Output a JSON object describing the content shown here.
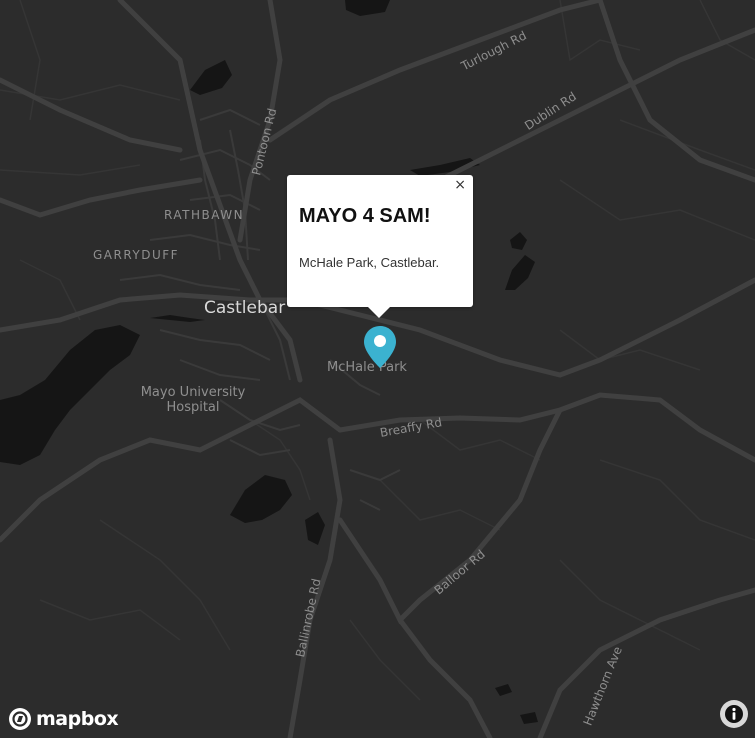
{
  "map": {
    "labels": {
      "town": "Castlebar",
      "rathbawn": "RATHBAWN",
      "garryduff": "GARRYDUFF",
      "hospital_line1": "Mayo University",
      "hospital_line2": "Hospital",
      "mchale_park": "McHale Park",
      "turlough_rd": "Turlough Rd",
      "dublin_rd": "Dublin Rd",
      "pontoon_rd": "Pontoon Rd",
      "breaffy_rd": "Breaffy Rd",
      "ballinrobe_rd": "Ballinrobe Rd",
      "balloor_rd": "Balloor Rd",
      "hawthorn_ave": "Hawthorn Ave"
    },
    "colors": {
      "background": "#2c2c2c",
      "road": "#3d3d3d",
      "water": "#151515",
      "marker": "#3bb2d0"
    }
  },
  "popup": {
    "title": "MAYO 4 SAM!",
    "body": "McHale Park, Castlebar.",
    "close": "×"
  },
  "marker": {
    "icon": "map-pin-icon"
  },
  "attribution": {
    "logo_text": "mapbox",
    "info_icon": "info-icon"
  }
}
